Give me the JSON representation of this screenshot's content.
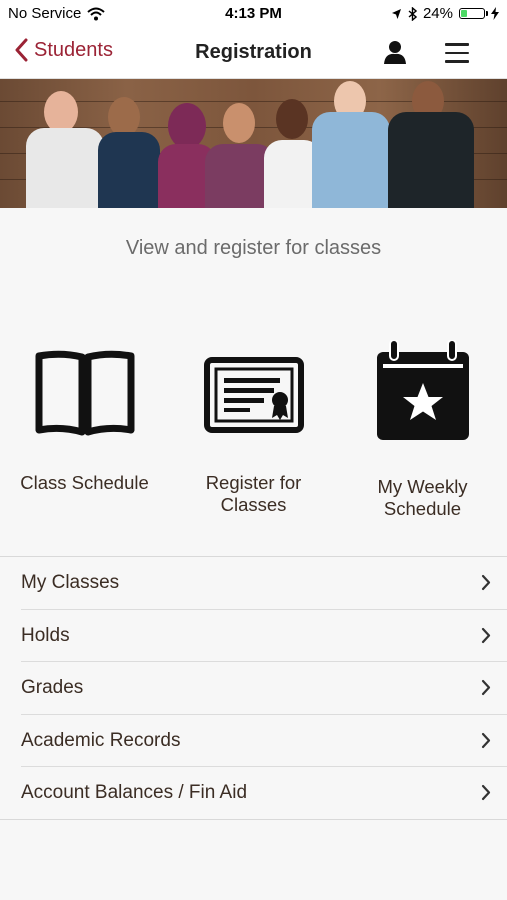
{
  "status_bar": {
    "carrier": "No Service",
    "time": "4:13 PM",
    "battery": "24%",
    "battery_level": 0.24,
    "icons": [
      "wifi-icon",
      "location-icon",
      "bluetooth-icon",
      "battery-icon",
      "charging-icon"
    ]
  },
  "nav": {
    "back_label": "Students",
    "title": "Registration",
    "accent_color": "#9b2335",
    "icons": [
      "back-chevron-icon",
      "user-icon",
      "hamburger-menu-icon"
    ]
  },
  "banner": {
    "description_icon": "group-photo-image"
  },
  "subtitle": "View and register for classes",
  "tiles": [
    {
      "label": "Class Schedule",
      "icon": "open-book-icon"
    },
    {
      "label": "Register for Classes",
      "icon": "certificate-icon"
    },
    {
      "label": "My Weekly Schedule",
      "icon": "calendar-star-icon"
    }
  ],
  "list": [
    {
      "label": "My Classes"
    },
    {
      "label": "Holds"
    },
    {
      "label": "Grades"
    },
    {
      "label": "Academic Records"
    },
    {
      "label": "Account Balances / Fin Aid"
    }
  ]
}
